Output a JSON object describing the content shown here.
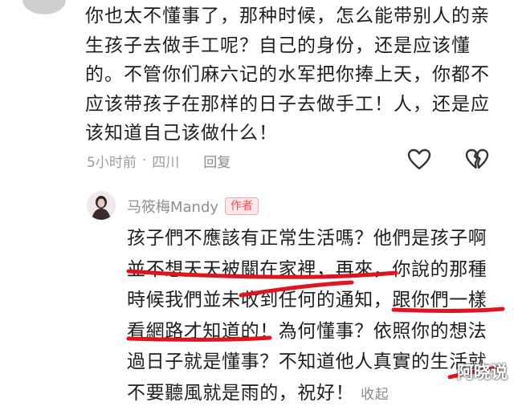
{
  "comment": {
    "text": "你也太不懂事了，那种时候，怎么能带别人的亲生孩子去做手工呢？自己的身份，还是应该懂的。不管你们麻六记的水军把你捧上天，你都不应该带孩子在那样的日子去做手工！人，还是应该知道自己该做什么！",
    "time": "5小时前",
    "separator": "·",
    "location": "四川",
    "reply_label": "回复",
    "like_icon": "heart-outline-icon",
    "dislike_icon": "broken-heart-icon"
  },
  "reply": {
    "author": "马筱梅Mandy",
    "badge": "作者",
    "text": "孩子們不應該有正常生活嗎？他們是孩子啊並不想天天被關在家裡，再來，你說的那種時候我們並未收到任何的通知，跟你們一樣看網路才知道的！為何懂事？依照你的想法過日子就是懂事？不知道他人真實的生活就不要聽風就是雨的，祝好！",
    "collapse_label": "收起",
    "highlight_color": "#e0141e"
  },
  "watermark": "阿晓说"
}
